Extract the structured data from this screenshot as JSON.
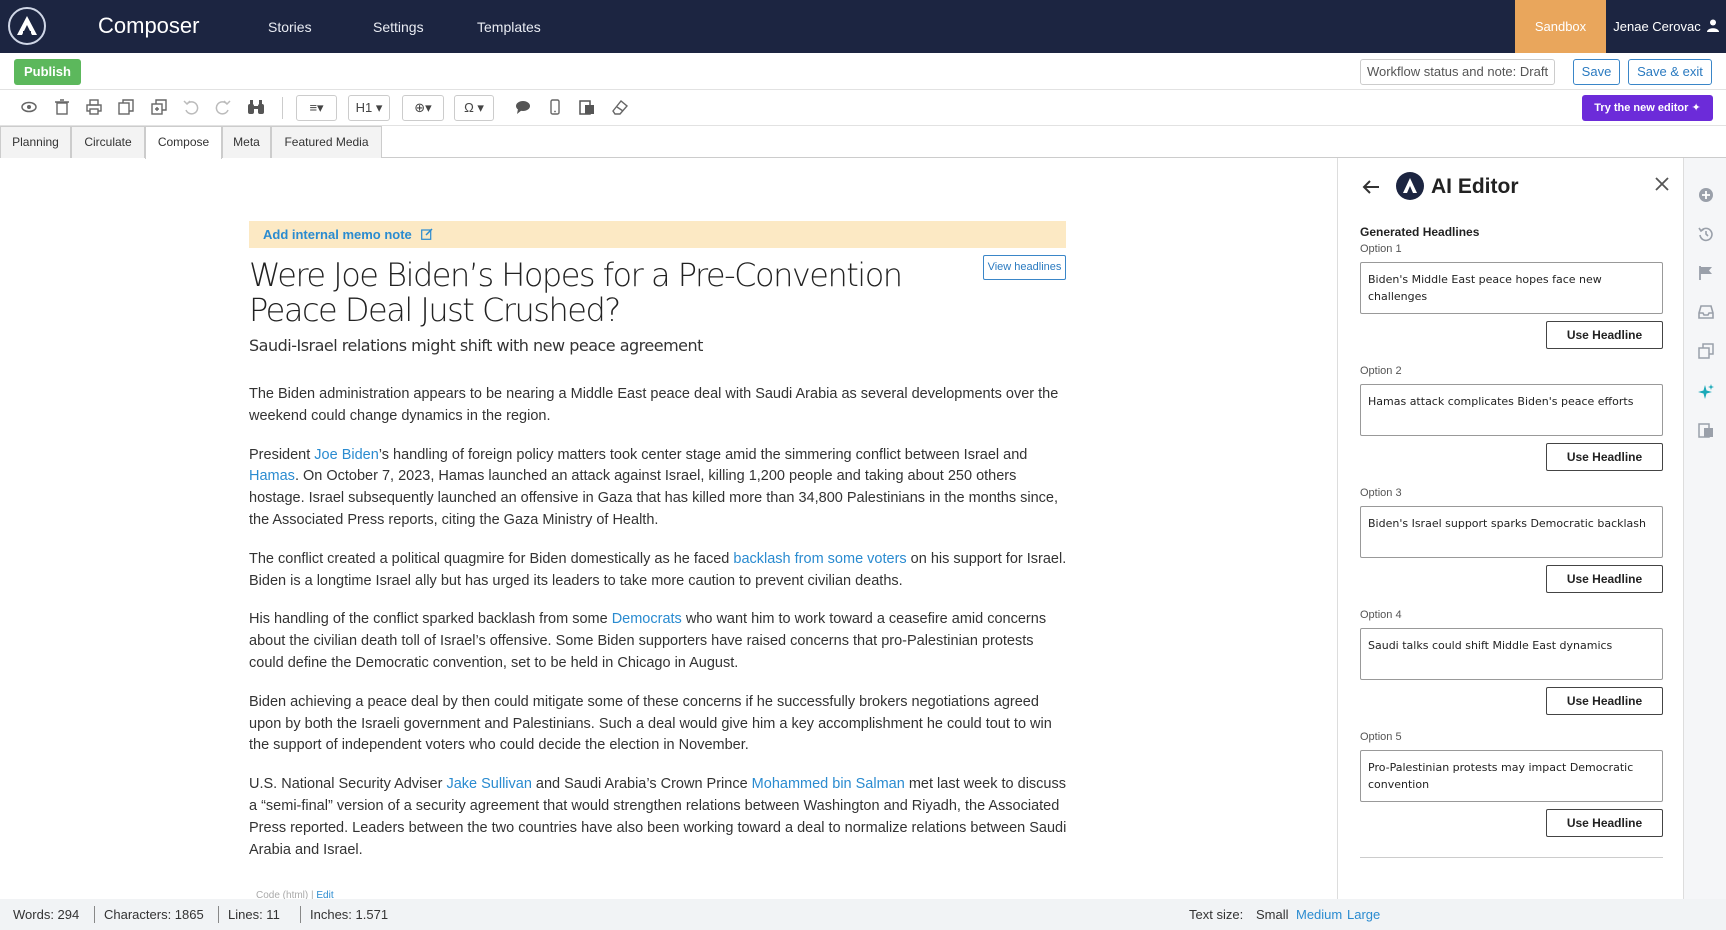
{
  "topnav": {
    "app_title": "Composer",
    "items": [
      "Stories",
      "Settings",
      "Templates"
    ],
    "environment": "Sandbox",
    "user_name": "Jenae Cerovac"
  },
  "actionbar": {
    "publish_label": "Publish",
    "workflow_label": "Workflow status and note: Draft",
    "save_label": "Save",
    "save_exit_label": "Save & exit"
  },
  "toolbar": {
    "align_label": "≡▾",
    "heading_label": "H1 ▾",
    "embed_label": "⊕▾",
    "special_char_label": "Ω ▾",
    "try_new_editor_label": "Try the new editor ✦"
  },
  "tabs": [
    "Planning",
    "Circulate",
    "Compose",
    "Meta",
    "Featured Media"
  ],
  "active_tab": "Compose",
  "article": {
    "memo_label": "Add internal memo note",
    "view_headlines_label": "View headlines",
    "headline": "Were Joe Biden’s Hopes for a Pre-Convention Peace Deal Just Crushed?",
    "subheadline": "Saudi-Israel relations might shift with new peace agreement",
    "paragraphs": {
      "p1": "The Biden administration appears to be nearing a Middle East peace deal with Saudi Arabia as several developments over the weekend could change dynamics in the region.",
      "p2_a": "President ",
      "p2_link1": "Joe Biden",
      "p2_b": "’s handling of foreign policy matters took center stage amid the simmering conflict between Israel and ",
      "p2_link2": "Hamas",
      "p2_c": ". On October 7, 2023, Hamas launched an attack against Israel, killing 1,200 people and taking about 250 others hostage. Israel subsequently launched an offensive in Gaza that has killed more than 34,800 Palestinians in the months since, the Associated Press reports, citing the Gaza Ministry of Health.",
      "p3_a": "The conflict created a political quagmire for Biden domestically as he faced ",
      "p3_link": "backlash from some voters",
      "p3_b": " on his support for Israel. Biden is a longtime Israel ally but has urged its leaders to take more caution to prevent civilian deaths.",
      "p4_a": "His handling of the conflict sparked backlash from some ",
      "p4_link": "Democrats",
      "p4_b": " who want him to work toward a ceasefire amid concerns about the civilian death toll of Israel’s offensive. Some Biden supporters have raised concerns that pro-Palestinian protests could define the Democratic convention, set to be held in Chicago in August.",
      "p5": "Biden achieving a peace deal by then could mitigate some of these concerns if he successfully brokers negotiations agreed upon by both the Israeli government and Palestinians. Such a deal would give him a key accomplishment he could tout to win the support of independent voters who could decide the election in November.",
      "p6_a": "U.S. National Security Adviser ",
      "p6_link1": "Jake Sullivan",
      "p6_b": " and Saudi Arabia’s Crown Prince ",
      "p6_link2": "Mohammed bin Salman",
      "p6_c": " met last week to discuss a “semi-final” version of a security agreement that would strengthen relations between Washington and Riyadh, the Associated Press reported. Leaders between the two countries have also been working toward a deal to normalize relations between Saudi Arabia and Israel."
    },
    "code_note": "Code (html) | ",
    "code_edit": "Edit"
  },
  "ai_panel": {
    "title": "AI Editor",
    "section_title": "Generated Headlines",
    "use_label": "Use Headline",
    "options": [
      {
        "label": "Option 1",
        "text": "Biden's Middle East peace hopes face new challenges"
      },
      {
        "label": "Option 2",
        "text": "Hamas attack complicates Biden's peace efforts"
      },
      {
        "label": "Option 3",
        "text": "Biden's Israel support sparks Democratic backlash"
      },
      {
        "label": "Option 4",
        "text": "Saudi talks could shift Middle East dynamics"
      },
      {
        "label": "Option 5",
        "text": "Pro-Palestinian protests may impact Democratic convention"
      }
    ]
  },
  "statusbar": {
    "words": "Words: 294",
    "characters": "Characters: 1865",
    "lines": "Lines: 11",
    "inches": "Inches: 1.571",
    "text_size_label": "Text size:",
    "sizes": [
      "Small",
      "Medium",
      "Large"
    ],
    "current_size": "Small"
  },
  "colors": {
    "nav_bg": "#1c2541",
    "sandbox": "#e9a65c",
    "publish": "#5cb85c",
    "link": "#2a8bd0",
    "try_editor": "#6c2bd9",
    "memo_bg": "#fce9c4"
  }
}
